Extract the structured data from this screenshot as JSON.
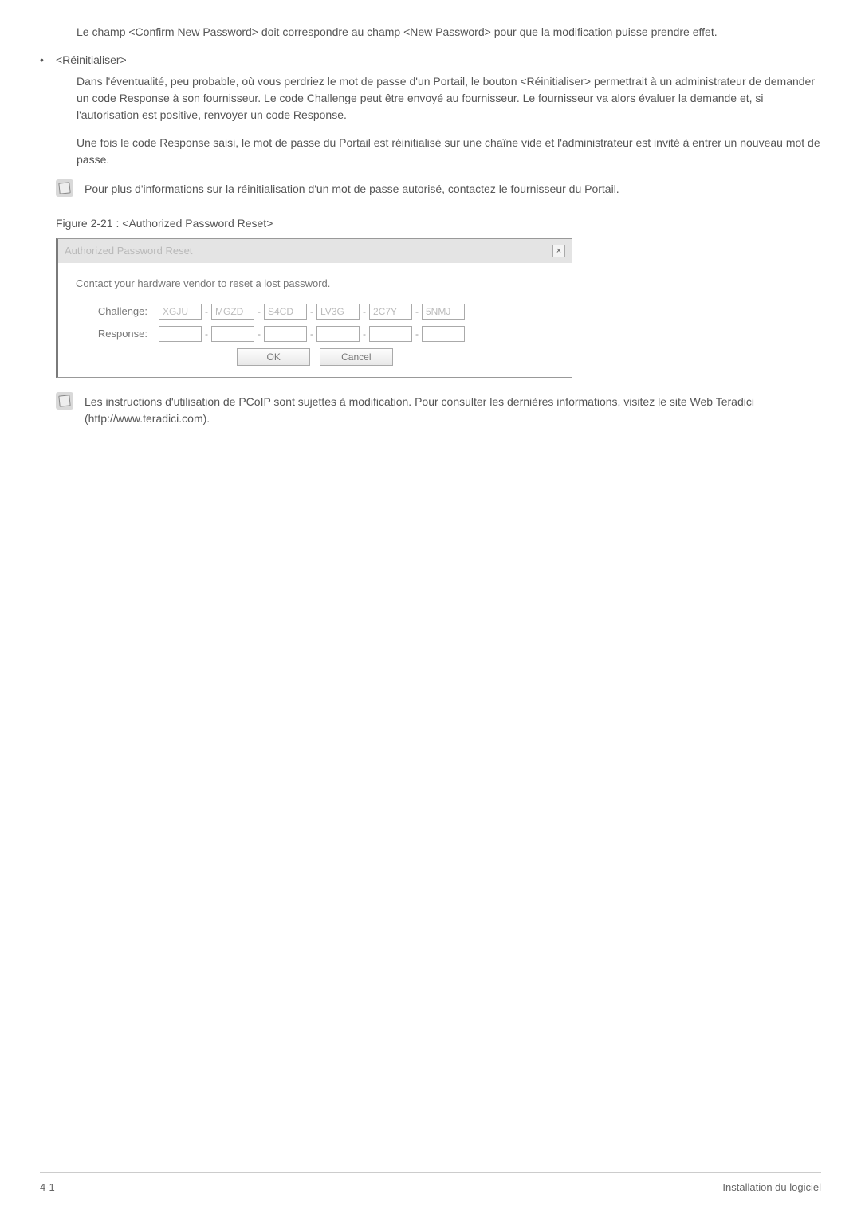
{
  "paragraphs": {
    "confirm_match": "Le champ <Confirm New Password> doit correspondre au champ <New Password> pour que la modification puisse prendre effet.",
    "reinit_bullet": "<Réinitialiser>",
    "reinit_body1": "Dans l'éventualité, peu probable, où vous perdriez le mot de passe d'un Portail, le bouton <Réinitialiser> permettrait à un administrateur de demander un code Response à son fournisseur. Le code Challenge peut être envoyé au fournisseur. Le fournisseur va alors évaluer la demande et, si l'autorisation est positive, renvoyer un code Response.",
    "reinit_body2": "Une fois le code Response saisi, le mot de passe du Portail est réinitialisé sur une chaîne vide et l'administrateur est invité à entrer un nouveau mot de passe.",
    "note1": "Pour plus d'informations sur la réinitialisation d'un mot de passe autorisé, contactez le fournisseur du Portail.",
    "figure_caption": "Figure 2-21 : <Authorized Password Reset>",
    "note2": "Les instructions d'utilisation de PCoIP sont sujettes à modification. Pour consulter les dernières informations, visitez le site Web Teradici (http://www.teradici.com)."
  },
  "dialog": {
    "title": "Authorized Password Reset",
    "close_glyph": "×",
    "instruction": "Contact your hardware vendor to reset a lost password.",
    "challenge_label": "Challenge:",
    "response_label": "Response:",
    "challenge_segments": [
      "XGJU",
      "MGZD",
      "S4CD",
      "LV3G",
      "2C7Y",
      "5NMJ"
    ],
    "response_segments": [
      "",
      "",
      "",
      "",
      "",
      ""
    ],
    "ok_label": "OK",
    "cancel_label": "Cancel"
  },
  "footer": {
    "left": "4-1",
    "right": "Installation du logiciel"
  }
}
